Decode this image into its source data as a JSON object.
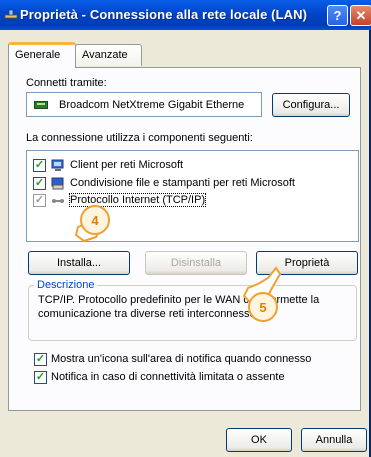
{
  "window": {
    "title": "Proprietà - Connessione alla rete locale (LAN)",
    "help_glyph": "?",
    "close_glyph": "✕"
  },
  "tabs": [
    {
      "label": "Generale",
      "active": true
    },
    {
      "label": "Avanzate",
      "active": false
    }
  ],
  "general": {
    "connect_using_label": "Connetti tramite:",
    "adapter_name": "Broadcom NetXtreme Gigabit Etherne",
    "configure_button": "Configura...",
    "components_label": "La connessione utilizza i componenti seguenti:",
    "components": [
      {
        "label": "Client per reti Microsoft",
        "checked": true,
        "icon": "network-client-icon"
      },
      {
        "label": "Condivisione file e stampanti per reti Microsoft",
        "checked": true,
        "icon": "file-printer-sharing-icon"
      },
      {
        "label": "Protocollo Internet (TCP/IP)",
        "checked": true,
        "icon": "protocol-icon",
        "selected": true
      }
    ],
    "install_button": "Installa...",
    "uninstall_button": "Disinstalla",
    "properties_button": "Proprietà",
    "description_legend": "Descrizione",
    "description_text": "TCP/IP. Protocollo predefinito per le WAN che permette la comunicazione tra diverse reti interconnesse.",
    "show_icon_option": {
      "label": "Mostra un'icona sull'area di notifica quando connesso",
      "checked": true
    },
    "notify_option": {
      "label": "Notifica in caso di connettività limitata o assente",
      "checked": true
    }
  },
  "footer": {
    "ok_button": "OK",
    "cancel_button": "Annulla"
  },
  "callouts": [
    {
      "number": "4",
      "target": "install-button"
    },
    {
      "number": "5",
      "target": "properties-button"
    }
  ],
  "colors": {
    "titlebar": "#0054e3",
    "dialog_bg": "#ece9d8",
    "tab_highlight": "#f8b53b",
    "group_title": "#0046d5",
    "callout": "#f0a030"
  }
}
